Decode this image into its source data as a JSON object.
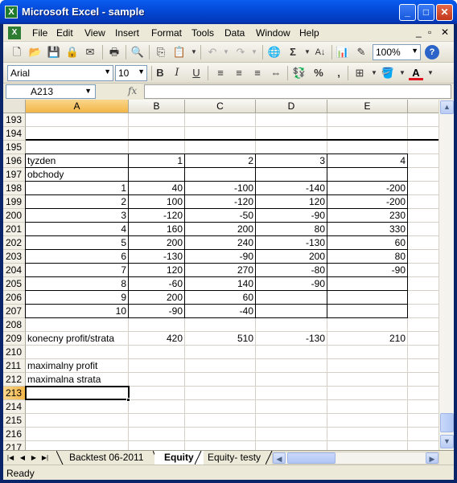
{
  "window": {
    "title": "Microsoft Excel - sample"
  },
  "menu": {
    "items": [
      "File",
      "Edit",
      "View",
      "Insert",
      "Format",
      "Tools",
      "Data",
      "Window",
      "Help"
    ]
  },
  "toolbar": {
    "zoom": "100%",
    "font": "Arial",
    "font_size": "10"
  },
  "formula_bar": {
    "name_box": "A213",
    "fx_label": "fx",
    "content": ""
  },
  "sheet": {
    "columns": [
      "A",
      "B",
      "C",
      "D",
      "E"
    ],
    "active_column": "A",
    "active_row": "213",
    "selected_cell": "A213",
    "rows": [
      {
        "num": "193",
        "cells": [
          "",
          "",
          "",
          "",
          ""
        ]
      },
      {
        "num": "194",
        "cells": [
          "",
          "",
          "",
          "",
          ""
        ]
      },
      {
        "num": "195",
        "cells": [
          "",
          "",
          "",
          "",
          ""
        ]
      },
      {
        "num": "196",
        "cells": [
          "tyzden",
          "1",
          "2",
          "3",
          "4"
        ]
      },
      {
        "num": "197",
        "cells": [
          "obchody",
          "",
          "",
          "",
          ""
        ]
      },
      {
        "num": "198",
        "cells": [
          "1",
          "40",
          "-100",
          "-140",
          "-200"
        ]
      },
      {
        "num": "199",
        "cells": [
          "2",
          "100",
          "-120",
          "120",
          "-200"
        ]
      },
      {
        "num": "200",
        "cells": [
          "3",
          "-120",
          "-50",
          "-90",
          "230"
        ]
      },
      {
        "num": "201",
        "cells": [
          "4",
          "160",
          "200",
          "80",
          "330"
        ]
      },
      {
        "num": "202",
        "cells": [
          "5",
          "200",
          "240",
          "-130",
          "60"
        ]
      },
      {
        "num": "203",
        "cells": [
          "6",
          "-130",
          "-90",
          "200",
          "80"
        ]
      },
      {
        "num": "204",
        "cells": [
          "7",
          "120",
          "270",
          "-80",
          "-90"
        ]
      },
      {
        "num": "205",
        "cells": [
          "8",
          "-60",
          "140",
          "-90",
          ""
        ]
      },
      {
        "num": "206",
        "cells": [
          "9",
          "200",
          "60",
          "",
          ""
        ]
      },
      {
        "num": "207",
        "cells": [
          "10",
          "-90",
          "-40",
          "",
          ""
        ]
      },
      {
        "num": "208",
        "cells": [
          "",
          "",
          "",
          "",
          ""
        ]
      },
      {
        "num": "209",
        "cells": [
          "konecny profit/strata",
          "420",
          "510",
          "-130",
          "210"
        ]
      },
      {
        "num": "210",
        "cells": [
          "",
          "",
          "",
          "",
          ""
        ]
      },
      {
        "num": "211",
        "cells": [
          "maximalny profit",
          "",
          "",
          "",
          ""
        ]
      },
      {
        "num": "212",
        "cells": [
          "maximalna strata",
          "",
          "",
          "",
          ""
        ]
      },
      {
        "num": "213",
        "cells": [
          "",
          "",
          "",
          "",
          ""
        ]
      },
      {
        "num": "214",
        "cells": [
          "",
          "",
          "",
          "",
          ""
        ]
      },
      {
        "num": "215",
        "cells": [
          "",
          "",
          "",
          "",
          ""
        ]
      },
      {
        "num": "216",
        "cells": [
          "",
          "",
          "",
          "",
          ""
        ]
      },
      {
        "num": "217",
        "cells": [
          "",
          "",
          "",
          "",
          ""
        ]
      }
    ]
  },
  "tabs": [
    {
      "label": "Backtest 06-2011",
      "active": false
    },
    {
      "label": "Equity",
      "active": true
    },
    {
      "label": "Equity- testy",
      "active": false
    }
  ],
  "status": {
    "text": "Ready"
  }
}
